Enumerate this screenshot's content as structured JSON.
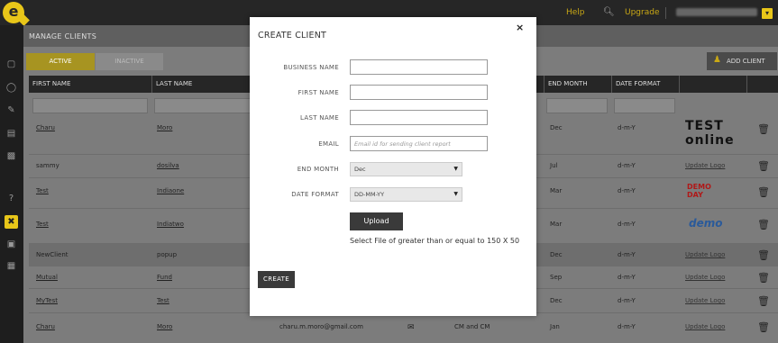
{
  "topbar": {
    "logo_letter": "e",
    "help": "Help",
    "upgrade": "Upgrade",
    "caret": "▾"
  },
  "page": {
    "header": "MANAGE CLIENTS",
    "tabs": {
      "active": "ACTIVE",
      "inactive": "INACTIVE"
    },
    "add_client": "ADD CLIENT",
    "columns": [
      "FIRST NAME",
      "LAST NAME",
      "END MONTH",
      "DATE FORMAT"
    ],
    "rows": [
      {
        "first": "Charu",
        "last": "Moro",
        "end_month": "Dec",
        "date_format": "d-m-Y",
        "logo": "TEST online"
      },
      {
        "first": "sammy",
        "last": "dosilva",
        "end_month": "Jul",
        "date_format": "d-m-Y",
        "logo": "Update Logo"
      },
      {
        "first": "Test",
        "last": "Indiaone",
        "end_month": "Mar",
        "date_format": "d-m-Y",
        "logo": "DEMO DAY"
      },
      {
        "first": "Test",
        "last": "Indiatwo",
        "end_month": "Mar",
        "date_format": "d-m-Y",
        "logo": "demo"
      },
      {
        "first": "NewClient",
        "last": "popup",
        "end_month": "Dec",
        "date_format": "d-m-Y",
        "logo": "Update Logo"
      },
      {
        "first": "Mutual",
        "last": "Fund",
        "end_month": "Sep",
        "date_format": "d-m-Y",
        "logo": "Update Logo"
      },
      {
        "first": "MyTest",
        "last": "Test",
        "end_month": "Dec",
        "date_format": "d-m-Y",
        "logo": "Update Logo"
      },
      {
        "first": "Charu",
        "last": "Moro",
        "email": "charu.m.moro@gmail.com",
        "business": "CM and CM",
        "end_month": "Jan",
        "date_format": "d-m-Y",
        "logo": "Update Logo"
      }
    ]
  },
  "modal": {
    "title": "CREATE CLIENT",
    "close": "×",
    "labels": {
      "business_name": "BUSINESS NAME",
      "first_name": "FIRST NAME",
      "last_name": "LAST NAME",
      "email": "EMAIL",
      "end_month": "END MONTH",
      "date_format": "DATE FORMAT"
    },
    "email_placeholder": "Email id for sending client report",
    "end_month_value": "Dec",
    "date_format_value": "DD-MM-YY",
    "upload_label": "Upload",
    "upload_note": "Select File of greater than or equal to 150 X 50",
    "create_label": "CREATE"
  }
}
